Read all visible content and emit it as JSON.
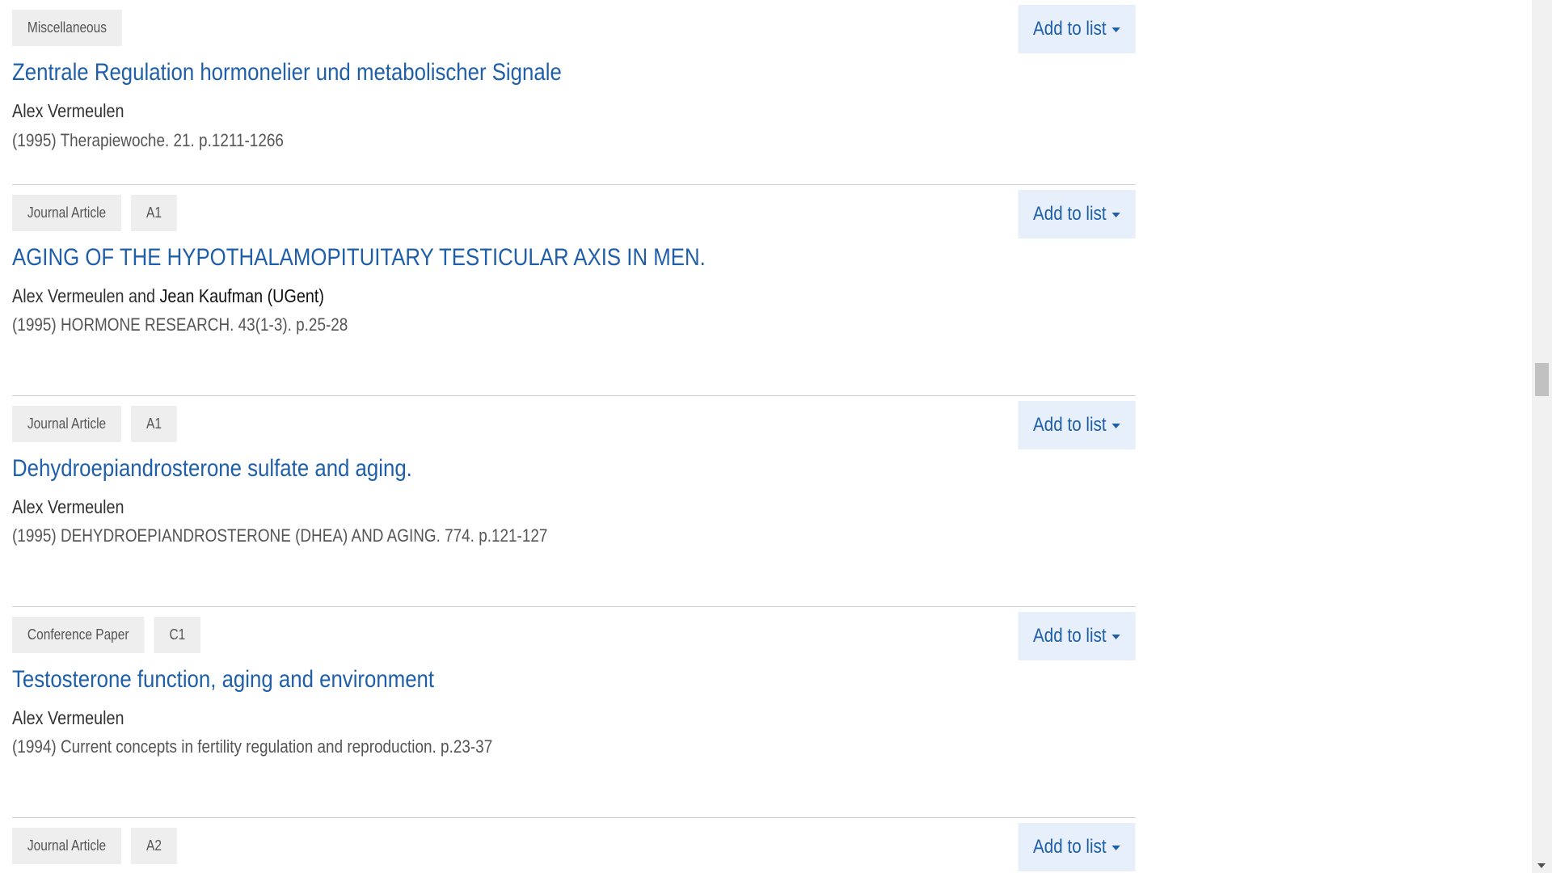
{
  "add_to_list_label": "Add to list",
  "records": [
    {
      "badges": [
        "Miscellaneous"
      ],
      "title": "Zentrale Regulation hormonelier und metabolischer Signale",
      "authors_plain": "Alex Vermeulen",
      "authors_ugent": "",
      "authors_joiner": "",
      "citation": "(1995) Therapiewoche. 21. p.1211-1266"
    },
    {
      "badges": [
        "Journal Article",
        "A1"
      ],
      "title": "AGING OF THE HYPOTHALAMOPITUITARY TESTICULAR AXIS IN MEN.",
      "authors_plain": "Alex Vermeulen",
      "authors_joiner": " and ",
      "authors_ugent": "Jean Kaufman (UGent)",
      "citation": "(1995) HORMONE RESEARCH. 43(1-3). p.25-28"
    },
    {
      "badges": [
        "Journal Article",
        "A1"
      ],
      "title": "Dehydroepiandrosterone sulfate and aging.",
      "authors_plain": "Alex Vermeulen",
      "authors_ugent": "",
      "authors_joiner": "",
      "citation": "(1995) DEHYDROEPIANDROSTERONE (DHEA) AND AGING. 774. p.121-127"
    },
    {
      "badges": [
        "Conference Paper",
        "C1"
      ],
      "title": "Testosterone function, aging and environment",
      "authors_plain": "Alex Vermeulen",
      "authors_ugent": "",
      "authors_joiner": "",
      "citation": "(1994) Current concepts in fertility regulation and reproduction. p.23-37"
    },
    {
      "badges": [
        "Journal Article",
        "A2"
      ],
      "title": "",
      "authors_plain": "",
      "authors_ugent": "",
      "authors_joiner": "",
      "citation": ""
    }
  ]
}
